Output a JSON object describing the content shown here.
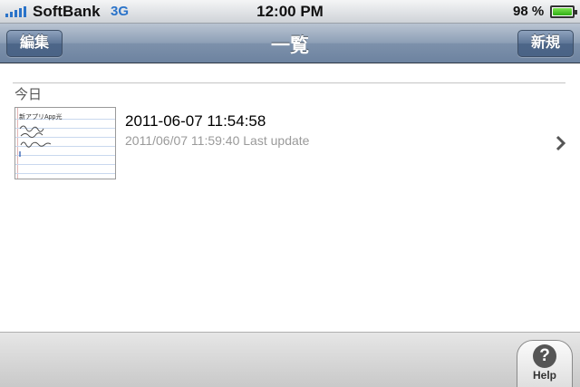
{
  "status_bar": {
    "carrier": "SoftBank",
    "network": "3G",
    "time": "12:00 PM",
    "battery": "98 %",
    "battery_level": 0.98
  },
  "nav_bar": {
    "title": "一覧",
    "edit_label": "編集",
    "new_label": "新規"
  },
  "section": {
    "title": "今日"
  },
  "notes": [
    {
      "title": "2011-06-07 11:54:58",
      "subtitle": "2011/06/07 11:59:40 Last update",
      "thumbnail_text": "新アプリApp光"
    }
  ],
  "toolbar": {
    "help_label": "Help",
    "help_glyph": "?"
  },
  "colors": {
    "nav_bar": "#7d91ab",
    "network": "#2a73c9",
    "battery": "#2fae14"
  }
}
